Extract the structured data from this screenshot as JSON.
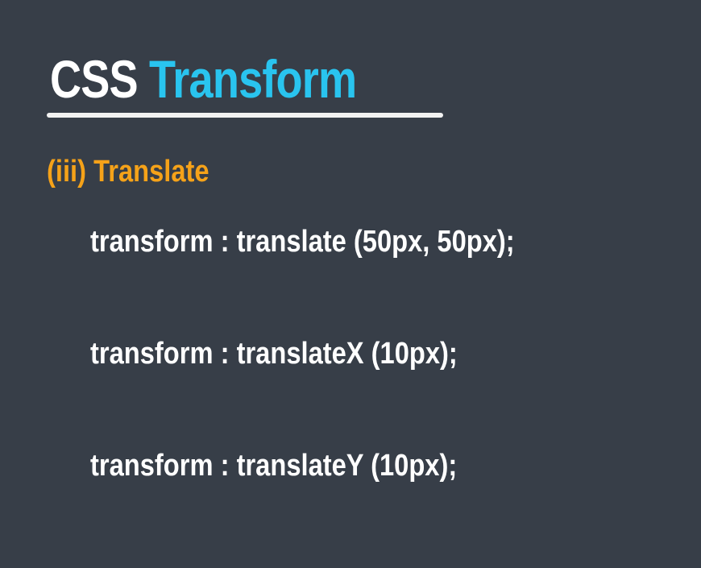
{
  "title": {
    "part1": "CSS",
    "part2": "Transform"
  },
  "subtitle": "(iii) Translate",
  "code_lines": [
    "transform : translate (50px, 50px);",
    "transform : translateX (10px);",
    "transform : translateY (10px);"
  ],
  "colors": {
    "background": "#373e48",
    "title_primary": "#ffffff",
    "title_accent": "#29c4ef",
    "subtitle": "#f5a219",
    "code_text": "#ffffff"
  }
}
